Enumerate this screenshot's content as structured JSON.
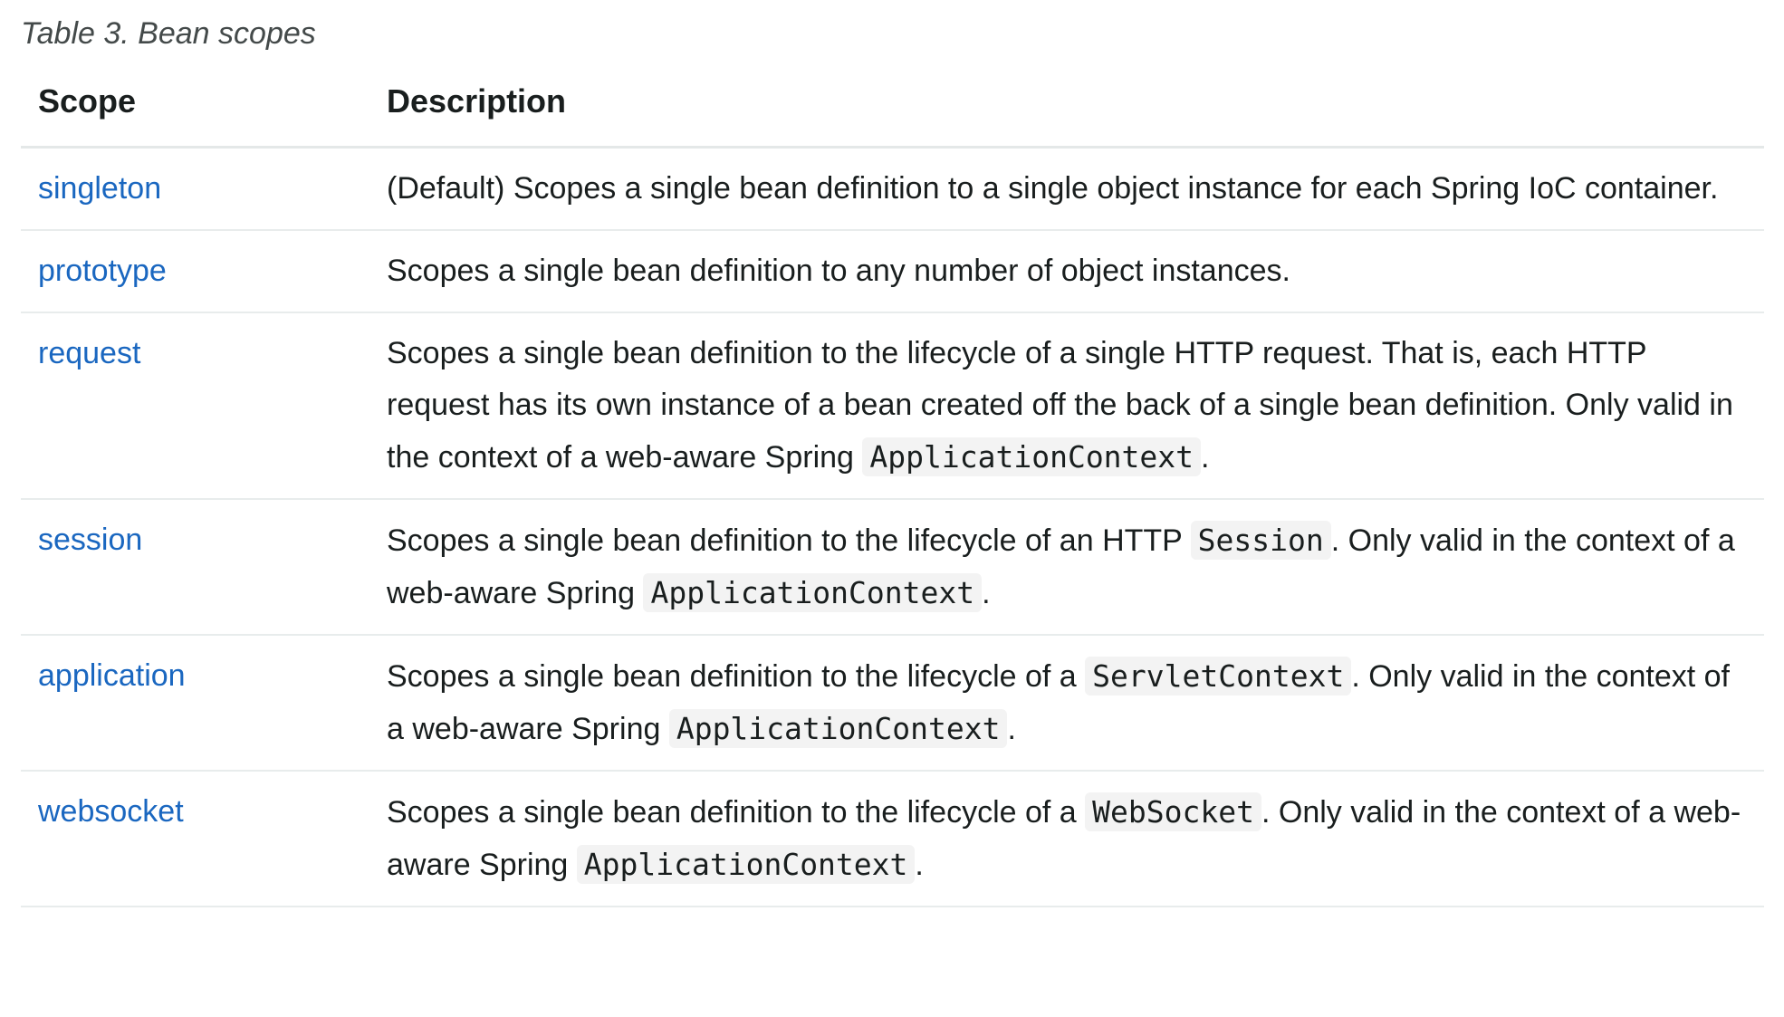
{
  "caption": "Table 3. Bean scopes",
  "headers": {
    "scope": "Scope",
    "description": "Description"
  },
  "colors": {
    "link": "#1a67c0",
    "text": "#191e1e",
    "code_bg": "#f3f3f3"
  },
  "rows": [
    {
      "scope": "singleton",
      "parts": [
        "(Default) Scopes a single bean definition to a single object instance for each Spring IoC container."
      ]
    },
    {
      "scope": "prototype",
      "parts": [
        "Scopes a single bean definition to any number of object instances."
      ]
    },
    {
      "scope": "request",
      "parts": [
        "Scopes a single bean definition to the lifecycle of a single HTTP request. That is, each HTTP request has its own instance of a bean created off the back of a single bean definition. Only valid in the context of a web-aware Spring ",
        "ApplicationContext",
        "."
      ]
    },
    {
      "scope": "session",
      "parts": [
        "Scopes a single bean definition to the lifecycle of an HTTP ",
        "Session",
        ". Only valid in the context of a web-aware Spring ",
        "ApplicationContext",
        "."
      ]
    },
    {
      "scope": "application",
      "parts": [
        "Scopes a single bean definition to the lifecycle of a ",
        "ServletContext",
        ". Only valid in the context of a web-aware Spring ",
        "ApplicationContext",
        "."
      ]
    },
    {
      "scope": "websocket",
      "parts": [
        "Scopes a single bean definition to the lifecycle of a ",
        "WebSocket",
        ". Only valid in the context of a web-aware Spring ",
        "ApplicationContext",
        "."
      ]
    }
  ]
}
